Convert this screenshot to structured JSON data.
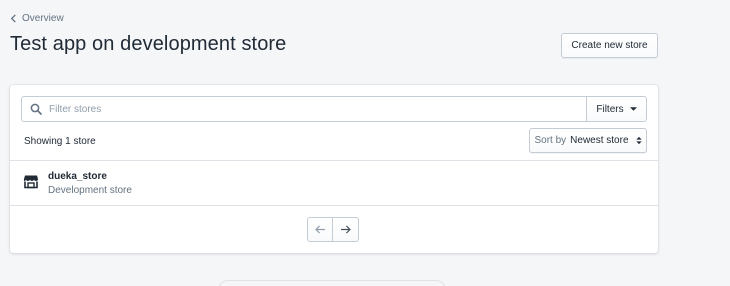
{
  "breadcrumb": {
    "label": "Overview",
    "icon": "chevron-left-icon"
  },
  "header": {
    "title": "Test app on development store",
    "create_button_label": "Create new store"
  },
  "filter_bar": {
    "search_placeholder": "Filter stores",
    "search_value": "",
    "search_icon": "search-icon",
    "filters_label": "Filters"
  },
  "results": {
    "showing_text": "Showing 1 store",
    "sort_prefix": "Sort by",
    "sort_value": "Newest store"
  },
  "stores": [
    {
      "name": "dueka_store",
      "type": "Development store",
      "icon": "store-icon"
    }
  ],
  "pagination": {
    "prev_icon": "arrow-left-icon",
    "next_icon": "arrow-right-icon"
  },
  "colors": {
    "background": "#f4f6f8",
    "text": "#212b36",
    "subdued_text": "#637381",
    "border": "#c4cdd5"
  }
}
